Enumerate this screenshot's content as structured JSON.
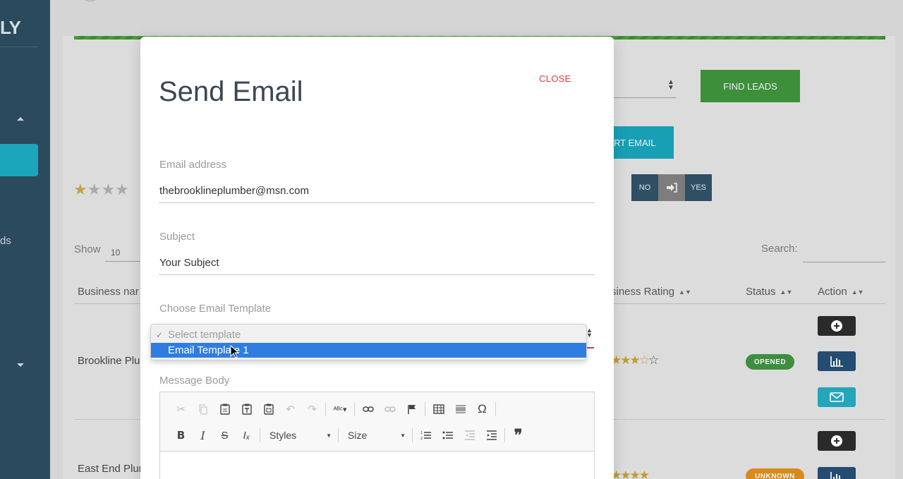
{
  "sidebar": {
    "logo_fragment": "LY",
    "nav_text_fragment": "ds"
  },
  "background": {
    "find_leads_label": "FIND LEADS",
    "export_email_label": "RT EMAIL",
    "toggle": {
      "no": "NO",
      "yes": "YES"
    },
    "show_label": "Show",
    "show_value": "10",
    "search_label": "Search:",
    "columns": {
      "business_name": "Business nar",
      "business_rating": "siness Rating",
      "status": "Status",
      "action": "Action"
    },
    "rows": [
      {
        "business": "Brookline Plu",
        "status": "OPENED"
      },
      {
        "business": "East End Plur",
        "status": "UNKNOWN"
      }
    ]
  },
  "modal": {
    "title": "Send Email",
    "close_label": "CLOSE",
    "email_address": {
      "label": "Email address",
      "value": "thebrooklineplumber@msn.com"
    },
    "subject": {
      "label": "Subject",
      "value": "Your Subject"
    },
    "template": {
      "label": "Choose Email Template",
      "options": [
        "Select template",
        "Email Template 1"
      ],
      "highlighted": "Email Template 1"
    },
    "message_body": {
      "label": "Message Body",
      "styles_label": "Styles",
      "size_label": "Size"
    }
  },
  "colors": {
    "sidebar": "#2b4a5d",
    "accent_teal": "#1ba6bc",
    "find_leads_green": "#3d8f3a",
    "close_red": "#e03b3b",
    "highlight_blue": "#2f7de0",
    "status_opened": "#3e8e3f",
    "status_unknown": "#d98a1d"
  }
}
